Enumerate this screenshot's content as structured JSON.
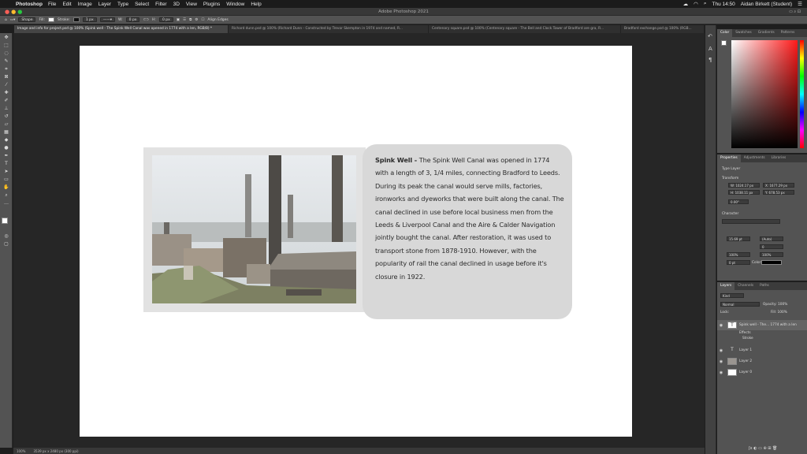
{
  "menubar": {
    "app": "Photoshop",
    "menus": [
      "File",
      "Edit",
      "Image",
      "Layer",
      "Type",
      "Select",
      "Filter",
      "3D",
      "View",
      "Plugins",
      "Window",
      "Help"
    ],
    "clock": "Thu 14:50",
    "user": "Aidan Birkett (Student)"
  },
  "window_title": "Adobe Photoshop 2021",
  "options": {
    "shape": "Shape",
    "fill": "Fill:",
    "stroke": "Stroke:",
    "stroke_size": "1 px",
    "w": "W:",
    "w_val": "0 px",
    "h": "H:",
    "h_val": "0 px",
    "align": "Align Edges"
  },
  "tabs": [
    "Image and info for project.psd @ 100% (Spink well - The Spink Well Canal was opened in 1774 with a len, RGB/8) *",
    "Richard dunn.psd @ 100% (Richard Dunn - Constructed by Trevor Skempton in 1974 and named, R...",
    "Centenary square.psd @ 100% (Centenary square - The Bell and Clock Tower of Bradford are gra, R...",
    "Bradford exchange.psd @ 100% (RGB..."
  ],
  "document": {
    "heading": "Spink Well - ",
    "body": "The Spink Well Canal was opened in 1774 with a length of 3, 1/4 miles, connecting Bradford to Leeds. During its peak the canal would serve mills, factories, ironworks and dyeworks that were built along the canal. The canal declined in use before local business men from the Leeds & Liverpool Canal and the Aire & Calder Navigation jointly bought the canal. After restoration, it was used to transport stone from 1878-1910. However, with the popularity of rail the canal declined in usage before it's closure in 1922."
  },
  "status": {
    "zoom": "100%",
    "size": "3539 px x 2480 px (300 ppi)"
  },
  "color_panel": {
    "tabs": [
      "Color",
      "Swatches",
      "Gradients",
      "Patterns"
    ]
  },
  "properties": {
    "tabs": [
      "Properties",
      "Adjustments",
      "Libraries"
    ],
    "kind": "Type Layer",
    "transform": "Transform",
    "w": "W: 1024.17 px",
    "x": "X: 1677.29 px",
    "h": "H: 1038.11 px",
    "y": "Y: 678.53 px",
    "angle": "0.00°",
    "character": "Character",
    "font_size": "15.69 pt",
    "leading": "(Auto)",
    "tracking": "0",
    "scale_v": "100%",
    "scale_h": "100%",
    "baseline": "0 pt",
    "color_label": "Color:"
  },
  "layers_panel": {
    "tabs": [
      "Layers",
      "Channels",
      "Paths"
    ],
    "kind": "Kind",
    "blend": "Normal",
    "opacity": "Opacity: 100%",
    "lock": "Lock:",
    "fill": "Fill: 100%",
    "layers": [
      {
        "name": "Spink well - The... 1774 with a len",
        "icon": "T"
      },
      {
        "name": "Effects",
        "icon": ""
      },
      {
        "name": "Stroke",
        "icon": ""
      },
      {
        "name": "Layer 1",
        "icon": "T"
      },
      {
        "name": "Layer 2",
        "icon": ""
      },
      {
        "name": "Layer 0",
        "icon": ""
      }
    ]
  },
  "colors": {
    "accent": "#2d5a8a",
    "picker_hue": "#ff1a1a"
  }
}
